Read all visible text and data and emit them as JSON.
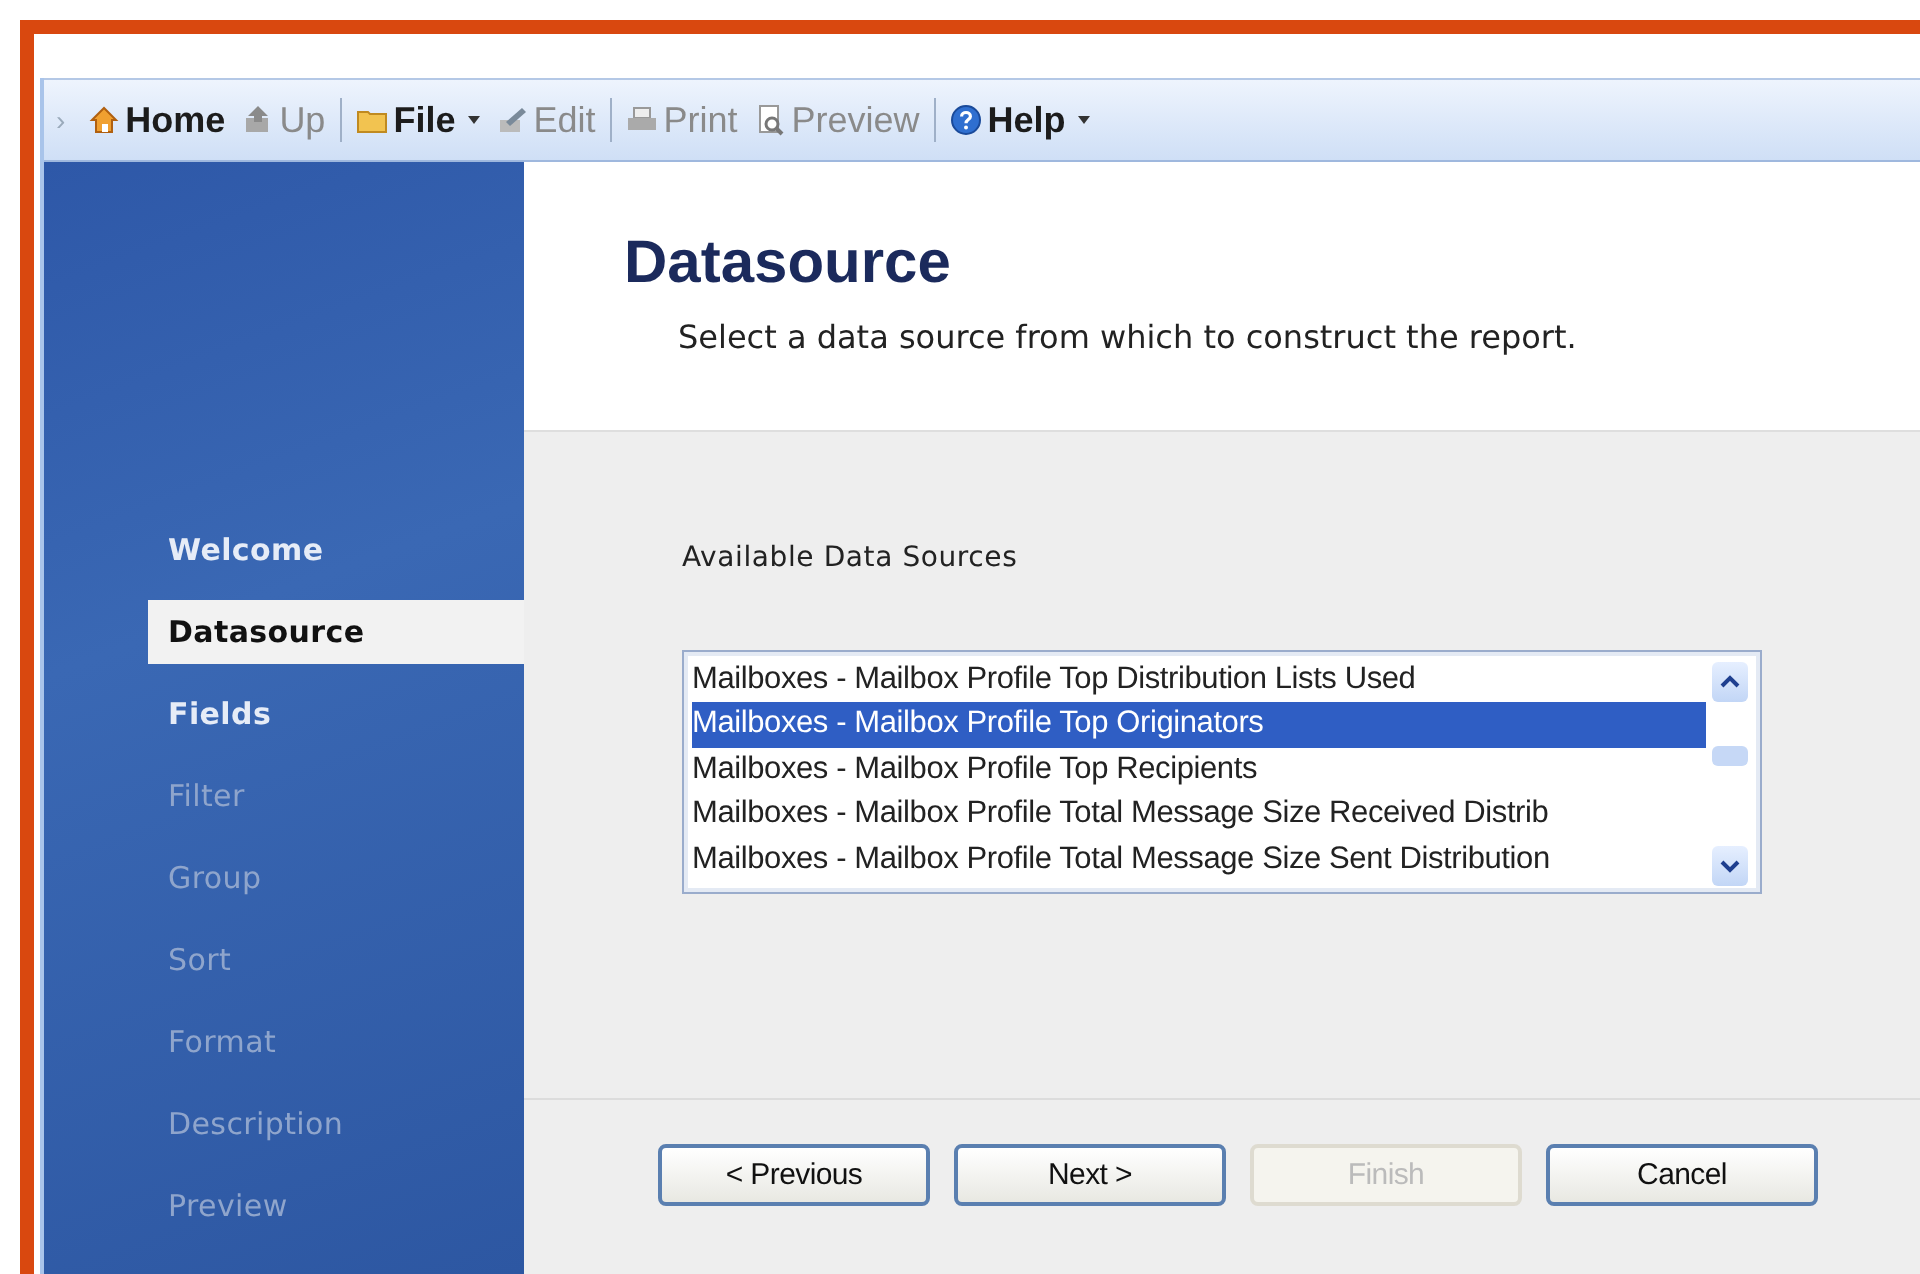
{
  "toolbar": {
    "items": [
      {
        "kind": "chevron",
        "label": "›"
      },
      {
        "kind": "button",
        "label": "Home",
        "disabled": false,
        "dropdown": false
      },
      {
        "kind": "button",
        "label": "Up",
        "disabled": true,
        "dropdown": false
      },
      {
        "kind": "separator"
      },
      {
        "kind": "button",
        "label": "File",
        "disabled": false,
        "dropdown": true
      },
      {
        "kind": "button",
        "label": "Edit",
        "disabled": true,
        "dropdown": false
      },
      {
        "kind": "separator"
      },
      {
        "kind": "button",
        "label": "Print",
        "disabled": true,
        "dropdown": false
      },
      {
        "kind": "button",
        "label": "Preview",
        "disabled": true,
        "dropdown": false
      },
      {
        "kind": "separator"
      },
      {
        "kind": "button",
        "label": "Help",
        "disabled": false,
        "dropdown": true
      }
    ]
  },
  "sidebar": {
    "items": [
      {
        "label": "Welcome",
        "selected": false,
        "disabled": false
      },
      {
        "label": "Datasource",
        "selected": true,
        "disabled": false
      },
      {
        "label": "Fields",
        "selected": false,
        "disabled": false
      },
      {
        "label": "Filter",
        "selected": false,
        "disabled": true
      },
      {
        "label": "Group",
        "selected": false,
        "disabled": true
      },
      {
        "label": "Sort",
        "selected": false,
        "disabled": true
      },
      {
        "label": "Format",
        "selected": false,
        "disabled": true
      },
      {
        "label": "Description",
        "selected": false,
        "disabled": true
      },
      {
        "label": "Preview",
        "selected": false,
        "disabled": true
      }
    ]
  },
  "header": {
    "title": "Datasource",
    "subtitle": "Select a data source from which to construct the report."
  },
  "data_sources": {
    "label": "Available Data Sources",
    "items": [
      {
        "label": "Mailboxes - Mailbox Profile Top Distribution Lists Used",
        "selected": false
      },
      {
        "label": "Mailboxes - Mailbox Profile Top Originators",
        "selected": true
      },
      {
        "label": "Mailboxes - Mailbox Profile Top Recipients",
        "selected": false
      },
      {
        "label": "Mailboxes - Mailbox Profile Total Message Size Received Distrib",
        "selected": false
      },
      {
        "label": "Mailboxes - Mailbox Profile Total Message Size Sent Distribution",
        "selected": false
      }
    ]
  },
  "buttons": [
    {
      "label": "< Previous",
      "disabled": false
    },
    {
      "label": "Next >",
      "disabled": false
    },
    {
      "label": "Finish",
      "disabled": true
    },
    {
      "label": "Cancel",
      "disabled": false
    }
  ]
}
